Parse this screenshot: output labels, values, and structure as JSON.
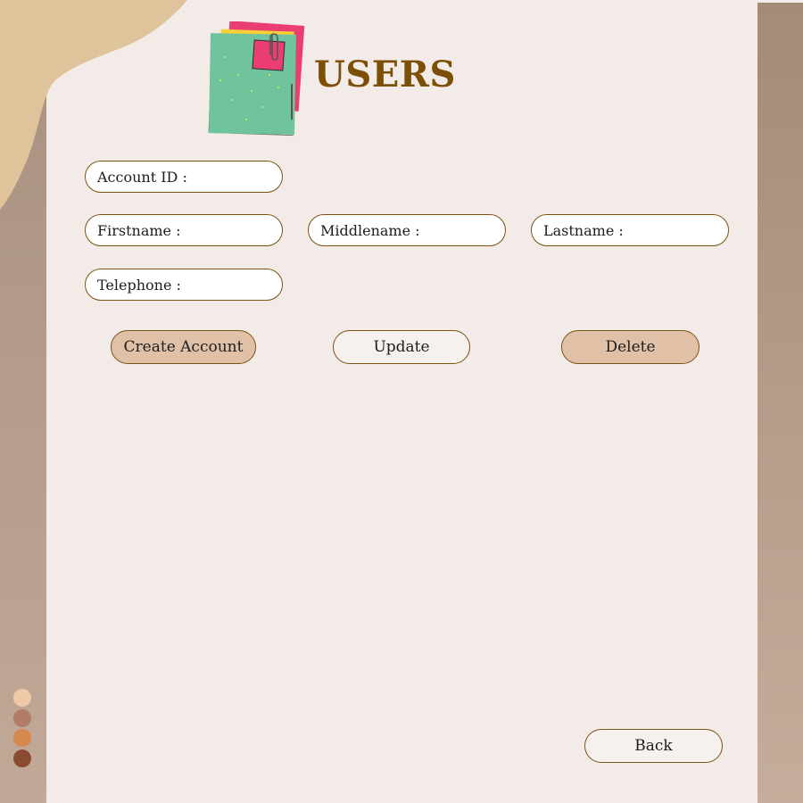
{
  "page": {
    "title": "USERS"
  },
  "fields": {
    "account_id": {
      "label": "Account ID :",
      "value": ""
    },
    "firstname": {
      "label": "Firstname :",
      "value": ""
    },
    "middlename": {
      "label": "Middlename :",
      "value": ""
    },
    "lastname": {
      "label": "Lastname :",
      "value": ""
    },
    "telephone": {
      "label": "Telephone :",
      "value": ""
    }
  },
  "buttons": {
    "create": "Create Account",
    "update": "Update",
    "delete": "Delete",
    "back": "Back"
  },
  "colors": {
    "title": "#7b4f06",
    "button_fill": "#e0c1a8",
    "border": "#7b5312",
    "swatches": [
      "#f0c9a8",
      "#b27c68",
      "#d4884e",
      "#8a4c30"
    ]
  }
}
